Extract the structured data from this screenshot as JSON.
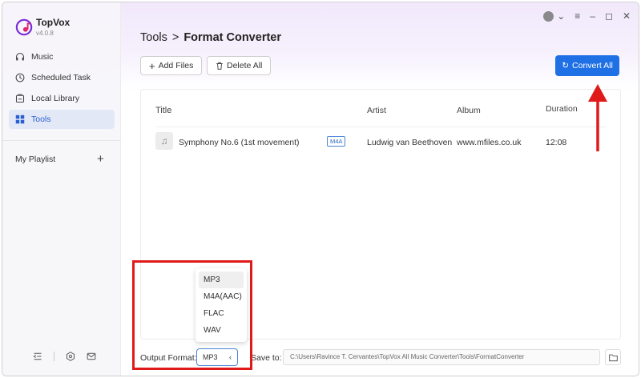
{
  "app": {
    "name": "TopVox",
    "version": "v4.0.8",
    "brand_color": "#7a2cd6"
  },
  "sidebar": {
    "items": [
      {
        "label": "Music",
        "icon": "headphones-icon"
      },
      {
        "label": "Scheduled Task",
        "icon": "clock-icon"
      },
      {
        "label": "Local Library",
        "icon": "library-icon"
      },
      {
        "label": "Tools",
        "icon": "grid-icon",
        "active": true
      }
    ],
    "playlist_label": "My Playlist",
    "footer_icons": [
      "collapse-icon",
      "settings-icon",
      "mail-icon"
    ]
  },
  "header": {
    "breadcrumb_root": "Tools",
    "breadcrumb_sep": ">",
    "breadcrumb_current": "Format Converter"
  },
  "toolbar": {
    "add_files": "Add Files",
    "delete_all": "Delete All",
    "convert_all": "Convert All",
    "accent": "#1f6fe5"
  },
  "table": {
    "headers": {
      "title": "Title",
      "artist": "Artist",
      "album": "Album",
      "duration": "Duration"
    },
    "rows": [
      {
        "title": "Symphony No.6 (1st movement)",
        "format": "M4A",
        "artist": "Ludwig van Beethoven",
        "album": "www.mfiles.co.uk",
        "duration": "12:08"
      }
    ]
  },
  "output": {
    "label": "Output Format:",
    "selected": "MP3",
    "options": [
      "MP3",
      "M4A(AAC)",
      "FLAC",
      "WAV"
    ]
  },
  "save": {
    "label": "Save to:",
    "path": "C:\\Users\\Ravince T. Cervantes\\TopVox All Music Converter\\Tools\\FormatConverter"
  },
  "annotation_color": "#e01a1a"
}
